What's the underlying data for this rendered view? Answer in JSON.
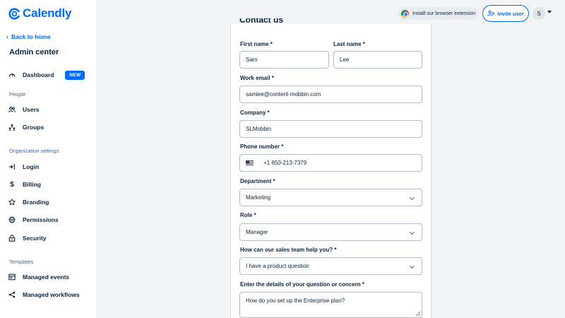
{
  "brand": {
    "name": "Calendly",
    "color": "#006bff"
  },
  "sidebar": {
    "back_label": "Back to home",
    "title": "Admin center",
    "dashboard": {
      "label": "Dashboard",
      "badge": "NEW",
      "icon": "gauge-icon"
    },
    "sections": {
      "people": "People",
      "org": "Organization settings",
      "templates": "Templates"
    },
    "people_items": [
      {
        "label": "Users",
        "icon": "users-icon"
      },
      {
        "label": "Groups",
        "icon": "groups-icon"
      }
    ],
    "org_items": [
      {
        "label": "Login",
        "icon": "login-icon"
      },
      {
        "label": "Billing",
        "icon": "dollar-icon"
      },
      {
        "label": "Branding",
        "icon": "star-icon"
      },
      {
        "label": "Permissions",
        "icon": "globe-icon"
      },
      {
        "label": "Security",
        "icon": "lock-icon"
      }
    ],
    "template_items": [
      {
        "label": "Managed events",
        "icon": "calendar-icon"
      },
      {
        "label": "Managed workflows",
        "icon": "workflow-icon"
      }
    ]
  },
  "topbar": {
    "extension_label": "Install our browser extension",
    "invite_label": "Invite user",
    "avatar_initial": "S"
  },
  "form": {
    "title": "Contact us",
    "first_name": {
      "label": "First name *",
      "value": "Sam"
    },
    "last_name": {
      "label": "Last name *",
      "value": "Lee"
    },
    "email": {
      "label": "Work email *",
      "value": "samlee@content-mobbin.com"
    },
    "company": {
      "label": "Company *",
      "value": "SLMobbin"
    },
    "phone": {
      "label": "Phone number *",
      "value": "+1 650-213-7379",
      "country": "us-flag-icon"
    },
    "department": {
      "label": "Department *",
      "value": "Marketing"
    },
    "role": {
      "label": "Role *",
      "value": "Manager"
    },
    "help": {
      "label": "How can our sales team help you? *",
      "value": "I have a product question"
    },
    "details": {
      "label": "Enter the details of your question or concern *",
      "value": "How do you set up the Enterprise plan?"
    }
  }
}
